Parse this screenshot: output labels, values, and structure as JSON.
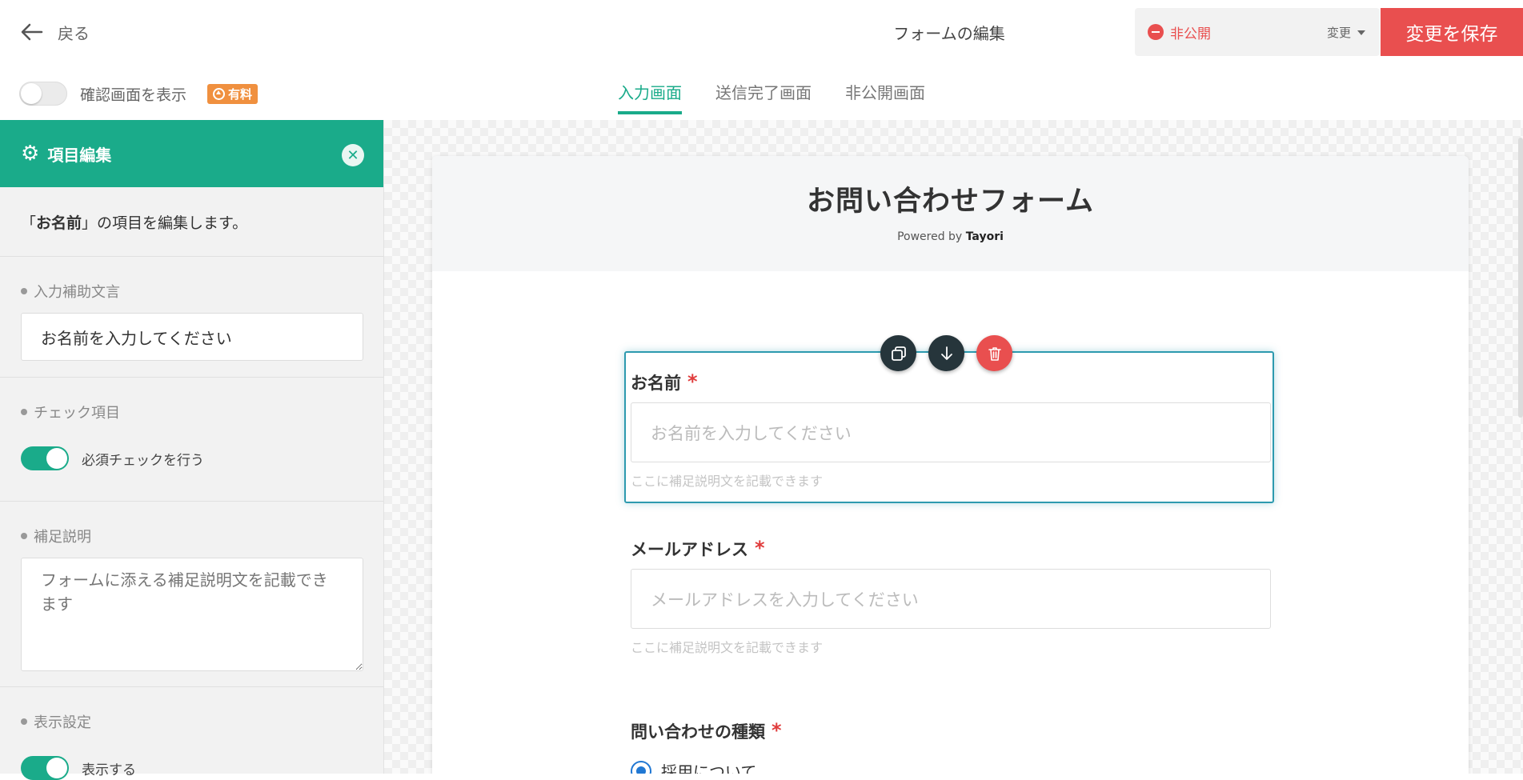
{
  "header": {
    "back_label": "戻る",
    "title": "フォームの編集",
    "status": "非公開",
    "change_label": "変更",
    "save_label": "変更を保存"
  },
  "subheader": {
    "confirm_label": "確認画面を表示",
    "confirm_enabled": false,
    "paid_badge": "有料"
  },
  "tabs": [
    {
      "label": "入力画面",
      "active": true
    },
    {
      "label": "送信完了画面",
      "active": false
    },
    {
      "label": "非公開画面",
      "active": false
    }
  ],
  "sidebar": {
    "title": "項目編集",
    "intro_prefix": "「",
    "intro_item": "お名前",
    "intro_suffix": "」の項目を編集します。",
    "placeholder_section_label": "入力補助文言",
    "placeholder_value": "お名前を入力してください",
    "check_section_label": "チェック項目",
    "required_check_label": "必須チェックを行う",
    "required_check_on": true,
    "note_section_label": "補足説明",
    "note_placeholder": "フォームに添える補足説明文を記載できます",
    "display_section_label": "表示設定",
    "display_label": "表示する",
    "display_on": true
  },
  "form": {
    "title": "お問い合わせフォーム",
    "powered_prefix": "Powered by",
    "powered_brand": "Tayori",
    "fields": [
      {
        "label": "お名前",
        "required_mark": "*",
        "placeholder": "お名前を入力してください",
        "hint": "ここに補足説明文を記載できます"
      },
      {
        "label": "メールアドレス",
        "required_mark": "*",
        "placeholder": "メールアドレスを入力してください",
        "hint": "ここに補足説明文を記載できます"
      },
      {
        "label": "問い合わせの種類",
        "required_mark": "*",
        "options": [
          "採用について"
        ]
      }
    ]
  },
  "colors": {
    "accent": "#1aab8a",
    "danger": "#e94f4f",
    "selected_border": "#2d9aaf",
    "badge": "#f0903f",
    "radio": "#2178d3"
  }
}
